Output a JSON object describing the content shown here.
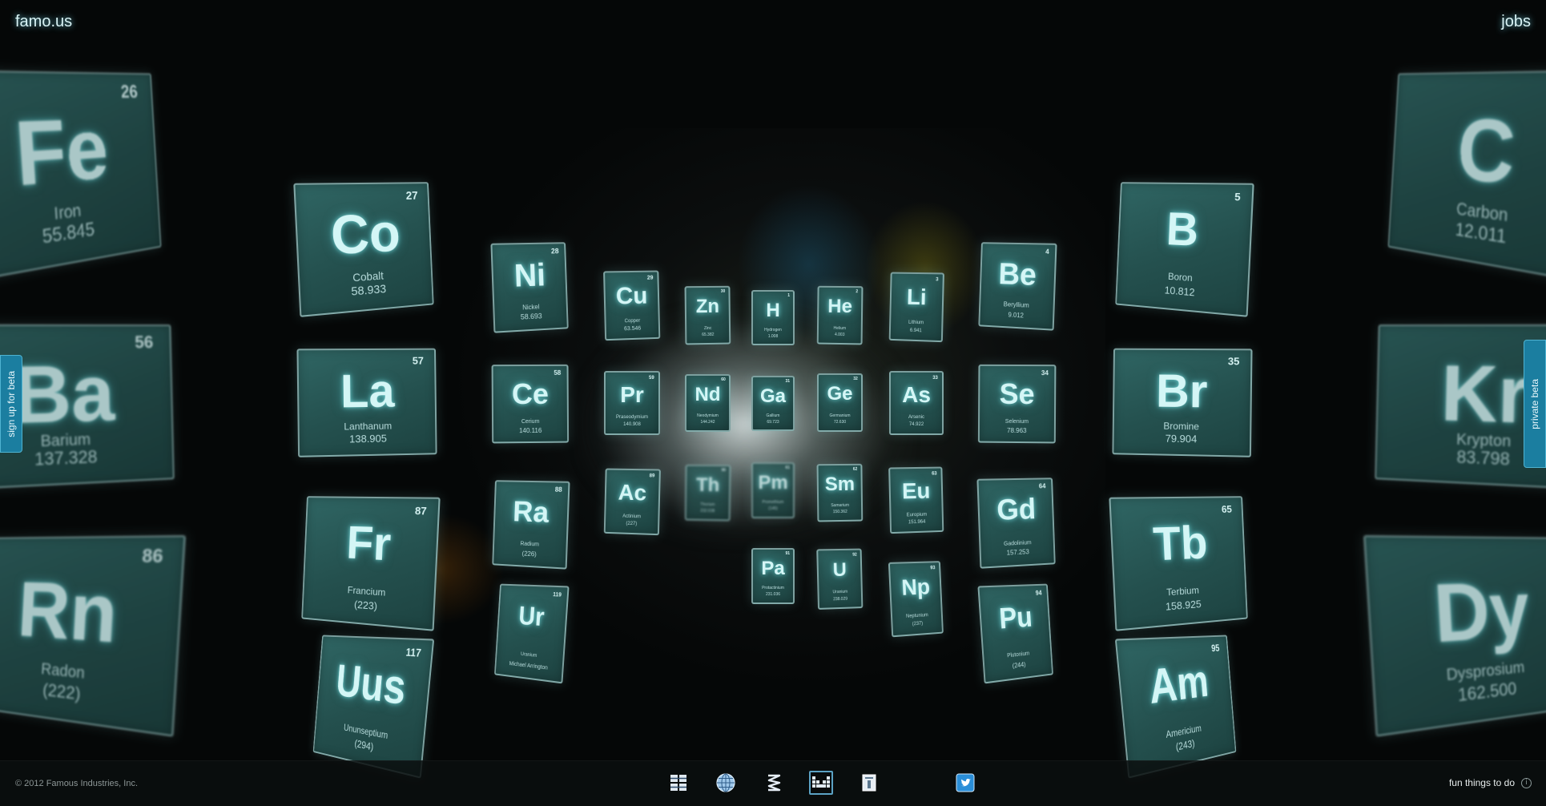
{
  "header": {
    "logo": "famo.us",
    "jobs_link": "jobs"
  },
  "side_tabs": {
    "left": "sign up for beta",
    "right": "private beta"
  },
  "tiles": [
    {
      "symbol": "Fe",
      "number": "26",
      "name": "Iron",
      "weight": "55.845"
    },
    {
      "symbol": "Ba",
      "number": "56",
      "name": "Barium",
      "weight": "137.328"
    },
    {
      "symbol": "Rn",
      "number": "86",
      "name": "Radon",
      "weight": "(222)"
    },
    {
      "symbol": "Co",
      "number": "27",
      "name": "Cobalt",
      "weight": "58.933"
    },
    {
      "symbol": "La",
      "number": "57",
      "name": "Lanthanum",
      "weight": "138.905"
    },
    {
      "symbol": "Fr",
      "number": "87",
      "name": "Francium",
      "weight": "(223)"
    },
    {
      "symbol": "Uus",
      "number": "117",
      "name": "Ununseptium",
      "weight": "(294)"
    },
    {
      "symbol": "Ni",
      "number": "28",
      "name": "Nickel",
      "weight": "58.693"
    },
    {
      "symbol": "Ce",
      "number": "58",
      "name": "Cerium",
      "weight": "140.116"
    },
    {
      "symbol": "Ra",
      "number": "88",
      "name": "Radium",
      "weight": "(226)"
    },
    {
      "symbol": "Ur",
      "number": "119",
      "name": "Uranium",
      "weight": "Michael Arrington"
    },
    {
      "symbol": "Cu",
      "number": "29",
      "name": "Copper",
      "weight": "63.546"
    },
    {
      "symbol": "Pr",
      "number": "59",
      "name": "Praseodymium",
      "weight": "140.908"
    },
    {
      "symbol": "Ac",
      "number": "89",
      "name": "Actinium",
      "weight": "(227)"
    },
    {
      "symbol": "Zn",
      "number": "30",
      "name": "Zinc",
      "weight": "65.382"
    },
    {
      "symbol": "Nd",
      "number": "60",
      "name": "Neodymium",
      "weight": "144.242"
    },
    {
      "symbol": "Th",
      "number": "90",
      "name": "Thorium",
      "weight": "232.038"
    },
    {
      "symbol": "H",
      "number": "1",
      "name": "Hydrogen",
      "weight": "1.008"
    },
    {
      "symbol": "Ga",
      "number": "31",
      "name": "Gallium",
      "weight": "69.723"
    },
    {
      "symbol": "Pm",
      "number": "61",
      "name": "Promethium",
      "weight": "(145)"
    },
    {
      "symbol": "Pa",
      "number": "91",
      "name": "Protactinium",
      "weight": "231.036"
    },
    {
      "symbol": "He",
      "number": "2",
      "name": "Helium",
      "weight": "4.003"
    },
    {
      "symbol": "Ge",
      "number": "32",
      "name": "Germanium",
      "weight": "72.630"
    },
    {
      "symbol": "Sm",
      "number": "62",
      "name": "Samarium",
      "weight": "150.362"
    },
    {
      "symbol": "U",
      "number": "92",
      "name": "Uranium",
      "weight": "238.029"
    },
    {
      "symbol": "Li",
      "number": "3",
      "name": "Lithium",
      "weight": "6.941"
    },
    {
      "symbol": "As",
      "number": "33",
      "name": "Arsenic",
      "weight": "74.922"
    },
    {
      "symbol": "Eu",
      "number": "63",
      "name": "Europium",
      "weight": "151.964"
    },
    {
      "symbol": "Np",
      "number": "93",
      "name": "Neptunium",
      "weight": "(237)"
    },
    {
      "symbol": "Be",
      "number": "4",
      "name": "Beryllium",
      "weight": "9.012"
    },
    {
      "symbol": "Se",
      "number": "34",
      "name": "Selenium",
      "weight": "78.963"
    },
    {
      "symbol": "Gd",
      "number": "64",
      "name": "Gadolinium",
      "weight": "157.253"
    },
    {
      "symbol": "Pu",
      "number": "94",
      "name": "Plutonium",
      "weight": "(244)"
    },
    {
      "symbol": "B",
      "number": "5",
      "name": "Boron",
      "weight": "10.812"
    },
    {
      "symbol": "Br",
      "number": "35",
      "name": "Bromine",
      "weight": "79.904"
    },
    {
      "symbol": "Tb",
      "number": "65",
      "name": "Terbium",
      "weight": "158.925"
    },
    {
      "symbol": "Am",
      "number": "95",
      "name": "Americium",
      "weight": "(243)"
    },
    {
      "symbol": "C",
      "number": "",
      "name": "Carbon",
      "weight": "12.011"
    },
    {
      "symbol": "Kr",
      "number": "",
      "name": "Krypton",
      "weight": "83.798"
    },
    {
      "symbol": "Dy",
      "number": "",
      "name": "Dysprosium",
      "weight": "162.500"
    }
  ],
  "footer": {
    "copyright": "© 2012 Famous Industries, Inc.",
    "fun_link": "fun things to do",
    "info_glyph": "i",
    "nav_icons": [
      {
        "icon": "grid-icon",
        "active": false
      },
      {
        "icon": "globe-icon",
        "active": false
      },
      {
        "icon": "zigzag-icon",
        "active": false
      },
      {
        "icon": "periodic-table-icon",
        "active": true
      },
      {
        "icon": "document-icon",
        "active": false
      },
      {
        "icon": "twitter-icon",
        "active": false
      }
    ]
  }
}
